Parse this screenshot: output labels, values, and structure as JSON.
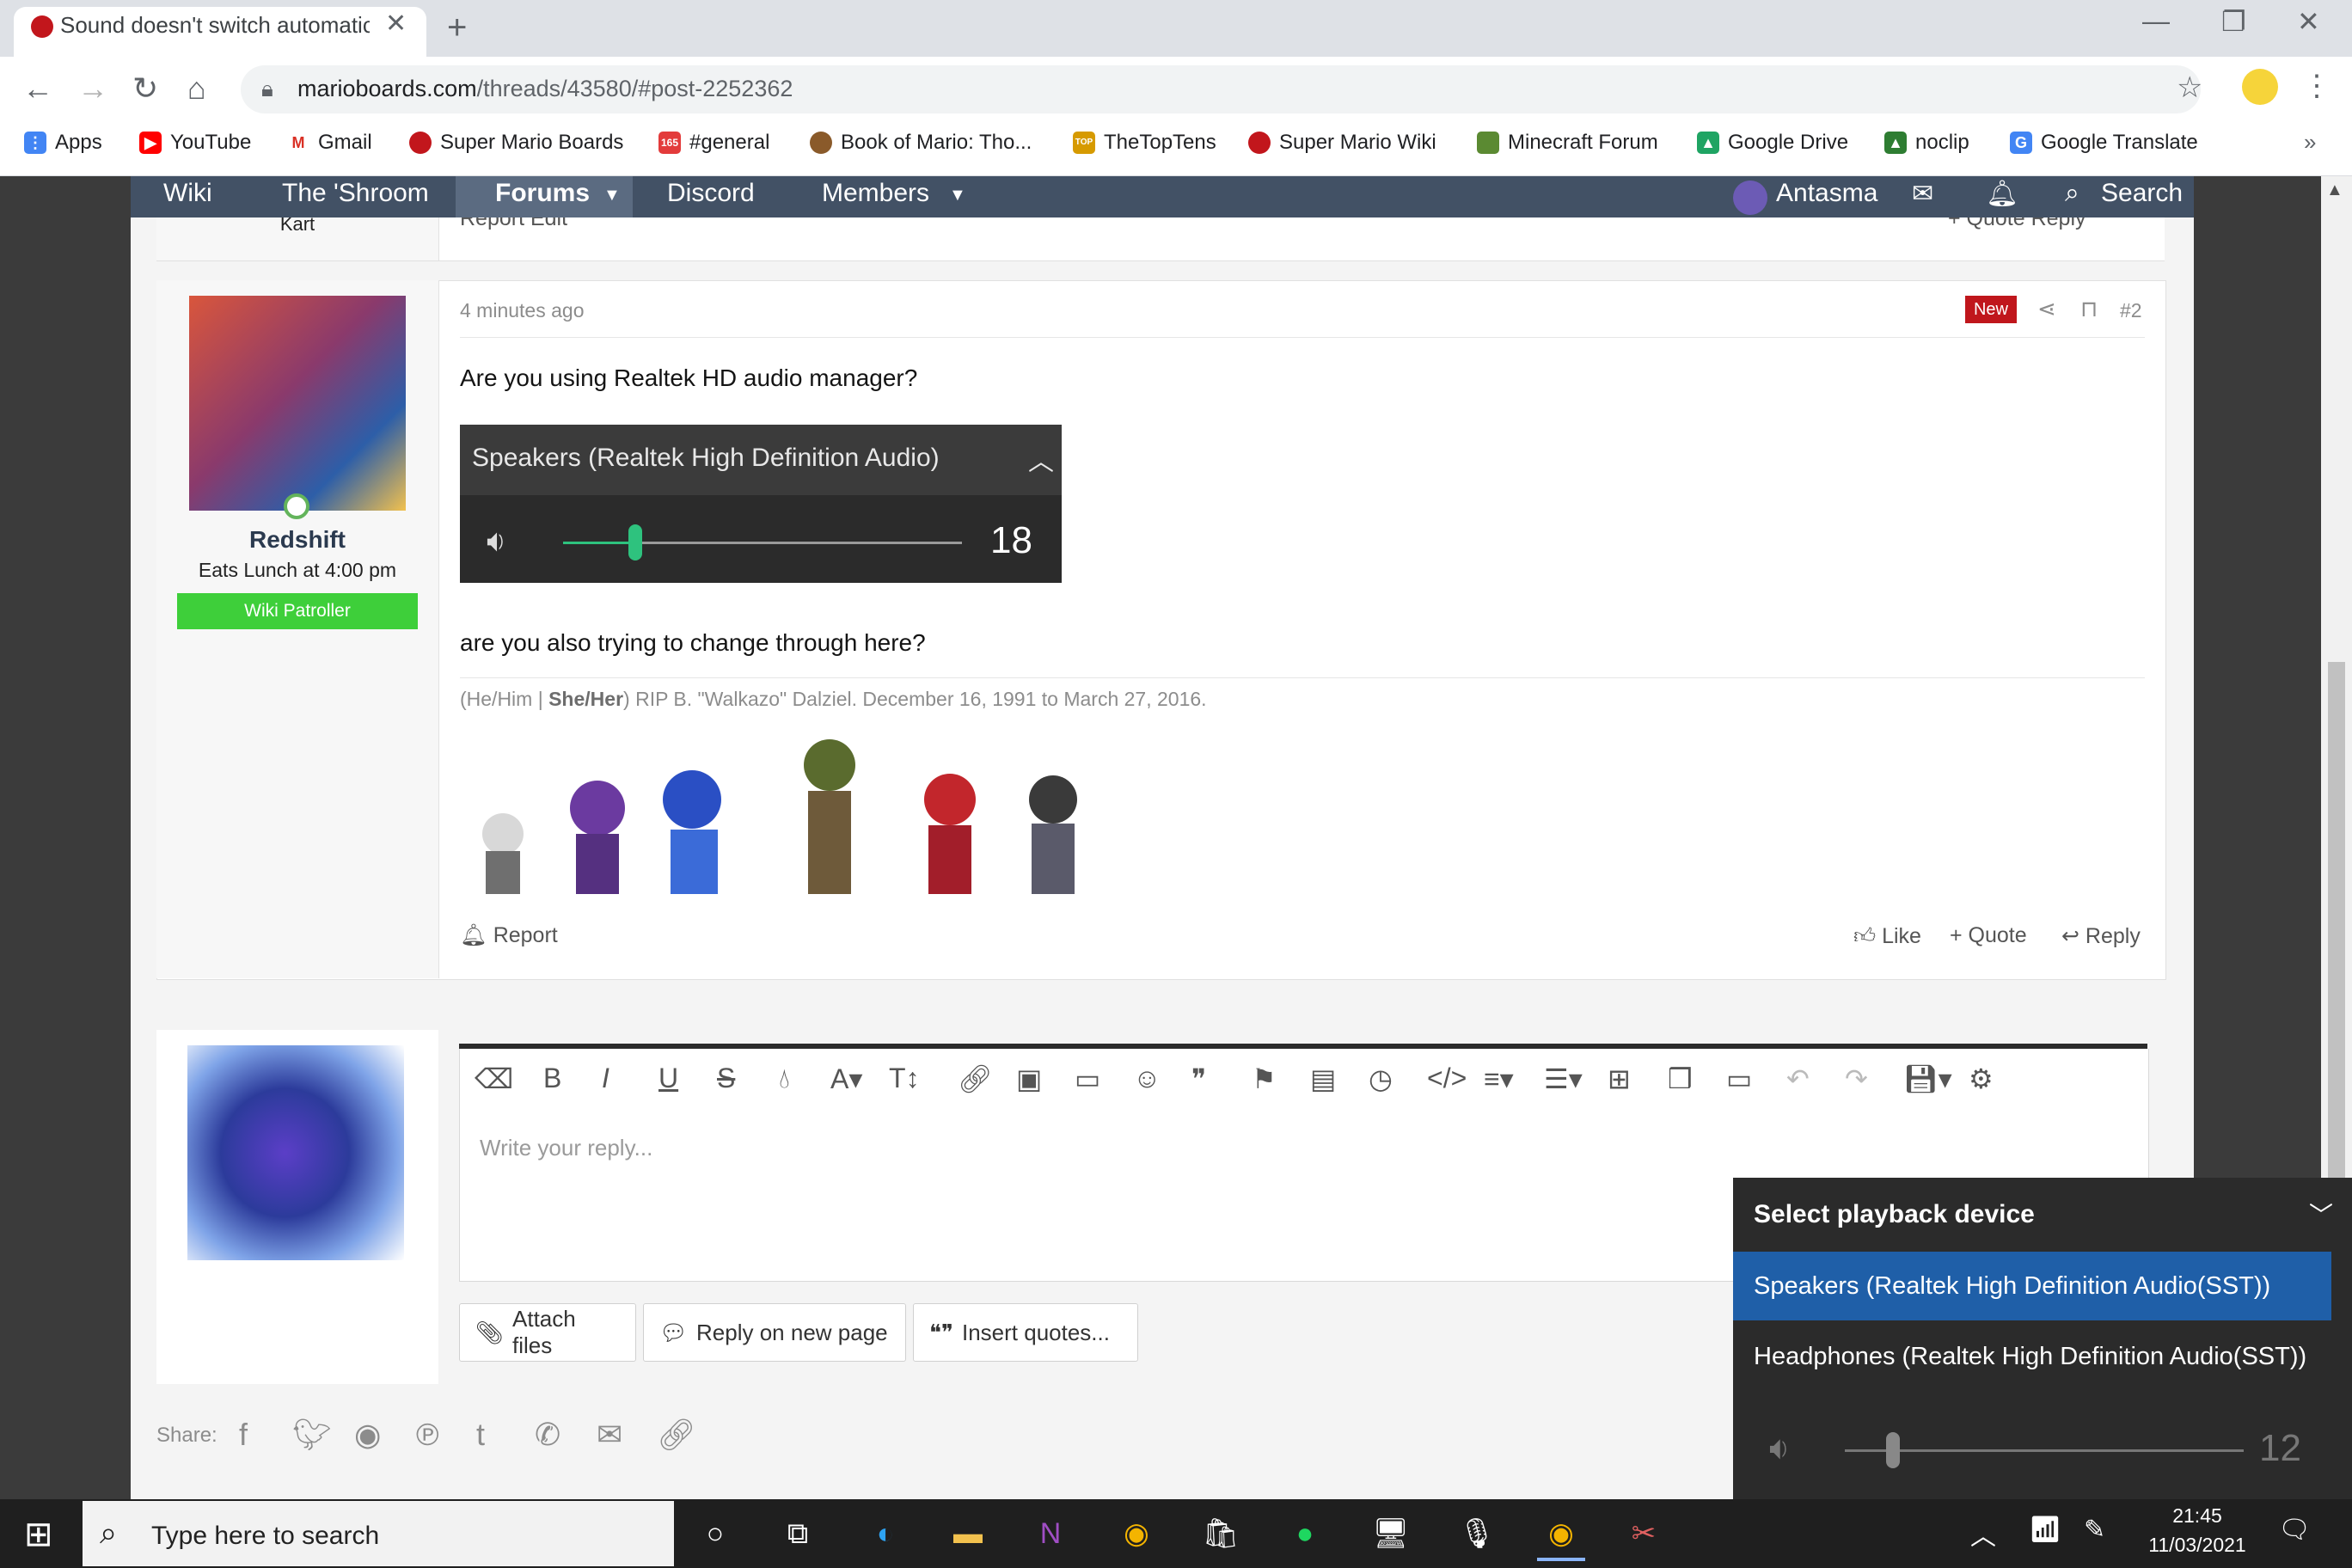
{
  "browser": {
    "tab_title": "Sound doesn't switch automatica",
    "url_host": "marioboards.com",
    "url_path": "/threads/43580/#post-2252362",
    "bookmarks": [
      {
        "label": "Apps",
        "icon": "apps-grid-icon",
        "color": "#4285f4"
      },
      {
        "label": "YouTube",
        "icon": "youtube-icon",
        "color": "#ff0000"
      },
      {
        "label": "Gmail",
        "icon": "gmail-icon",
        "color": "#d93025"
      },
      {
        "label": "Super Mario Boards",
        "icon": "mario-icon",
        "color": "#c2161c"
      },
      {
        "label": "#general",
        "icon": "discord-badge-icon",
        "color": "#e33b3b"
      },
      {
        "label": "Book of Mario: Tho...",
        "icon": "book-of-mario-icon",
        "color": "#8a5a2a"
      },
      {
        "label": "TheTopTens",
        "icon": "thetoptens-icon",
        "color": "#d69a00"
      },
      {
        "label": "Super Mario Wiki",
        "icon": "mario-wiki-icon",
        "color": "#c2161c"
      },
      {
        "label": "Minecraft Forum",
        "icon": "minecraft-icon",
        "color": "#5b8a32"
      },
      {
        "label": "Google Drive",
        "icon": "google-drive-icon",
        "color": "#1fa463"
      },
      {
        "label": "noclip",
        "icon": "noclip-icon",
        "color": "#2e7d32"
      },
      {
        "label": "Google Translate",
        "icon": "google-translate-icon",
        "color": "#4285f4"
      }
    ]
  },
  "site_nav": {
    "wiki": "Wiki",
    "shroom": "The 'Shroom",
    "forums": "Forums",
    "discord": "Discord",
    "members": "Members",
    "user": "Antasma",
    "search": "Search"
  },
  "prev_post": {
    "user_line": "Kart",
    "actions_left": "Report   Edit",
    "actions_right": "+ Quote   Reply"
  },
  "post": {
    "time": "4 minutes ago",
    "badge": "New",
    "number": "#2",
    "username": "Redshift",
    "user_title": "Eats Lunch at 4:00 pm",
    "user_banner": "Wiki Patroller",
    "line1": "Are you using Realtek HD audio manager?",
    "line2": "are you also trying to change through here?",
    "signature_pre": "(He/Him | ",
    "signature_bold": "She/Her",
    "signature_post": ") RIP B. \"Walkazo\" Dalziel. December 16, 1991 to March 27, 2016.",
    "report": "Report",
    "like": "Like",
    "quote": "+ Quote",
    "reply": "Reply"
  },
  "audio_widget": {
    "title": "Speakers (Realtek High Definition Audio)",
    "volume": "18",
    "volume_level": 0.18
  },
  "editor": {
    "placeholder": "Write your reply...",
    "attach": "Attach files",
    "reply_new_page": "Reply on new page",
    "insert_quotes": "Insert quotes..."
  },
  "share": {
    "label": "Share:"
  },
  "playback_flyout": {
    "title": "Select playback device",
    "option_selected": "Speakers (Realtek High Definition Audio(SST))",
    "option_other": "Headphones (Realtek High Definition Audio(SST))",
    "volume": "12",
    "volume_level": 0.12,
    "accent": "#1f5fa8"
  },
  "taskbar": {
    "search_placeholder": "Type here to search",
    "time": "21:45",
    "date": "11/03/2021"
  }
}
